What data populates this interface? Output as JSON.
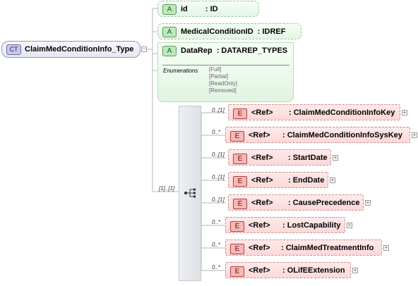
{
  "complex_type": {
    "badge": "CT",
    "name": "ClaimMedConditionInfo_Type"
  },
  "attributes": [
    {
      "badge": "A",
      "name": "id",
      "type": ": ID"
    },
    {
      "badge": "A",
      "name": "MedicalConditionID",
      "type": ": IDREF"
    },
    {
      "badge": "A",
      "name": "DataRep",
      "type": ": DATAREP_TYPES"
    }
  ],
  "enumerations": {
    "title": "Enumerations",
    "values": [
      "[Full]",
      "[Partial]",
      "[ReadOnly]",
      "[Removed]"
    ]
  },
  "sequence": {
    "cardinality": "[1]..[1]"
  },
  "elements": [
    {
      "badge": "E",
      "ref": "<Ref>",
      "name": ": ClaimMedConditionInfoKey",
      "cardinality": "0..[1]"
    },
    {
      "badge": "E",
      "ref": "<Ref>",
      "name": ": ClaimMedConditionInfoSysKey",
      "cardinality": "0..*"
    },
    {
      "badge": "E",
      "ref": "<Ref>",
      "name": ": StartDate",
      "cardinality": "0..[1]"
    },
    {
      "badge": "E",
      "ref": "<Ref>",
      "name": ": EndDate",
      "cardinality": "0..[1]"
    },
    {
      "badge": "E",
      "ref": "<Ref>",
      "name": ": CausePrecedence",
      "cardinality": "0..[1]"
    },
    {
      "badge": "E",
      "ref": "<Ref>",
      "name": ": LostCapability",
      "cardinality": "0..*"
    },
    {
      "badge": "E",
      "ref": "<Ref>",
      "name": ": ClaimMedTreatmentInfo",
      "cardinality": "0..*"
    },
    {
      "badge": "E",
      "ref": "<Ref>",
      "name": ": OLifEExtension",
      "cardinality": "0..*"
    }
  ]
}
